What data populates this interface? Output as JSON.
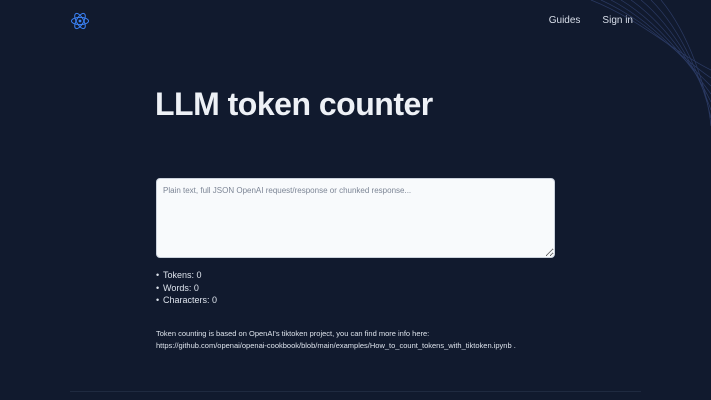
{
  "nav": {
    "guides": "Guides",
    "signin": "Sign in"
  },
  "title": "LLM token counter",
  "input": {
    "placeholder": "Plain text, full JSON OpenAI request/response or chunked response...",
    "value": ""
  },
  "stats": [
    {
      "label": "Tokens: 0"
    },
    {
      "label": "Words: 0"
    },
    {
      "label": "Characters: 0"
    }
  ],
  "info": {
    "line1": "Token counting is based on OpenAI's tiktoken project, you can find more info here:",
    "link": "https://github.com/openai/openai-cookbook/blob/main/examples/How_to_count_tokens_with_tiktoken.ipynb",
    "tail": " ."
  },
  "icons": {
    "logo": "atom-logo-icon"
  },
  "colors": {
    "background": "#111a2e",
    "accent": "#3b82f6",
    "text": "#e5e9f0"
  }
}
